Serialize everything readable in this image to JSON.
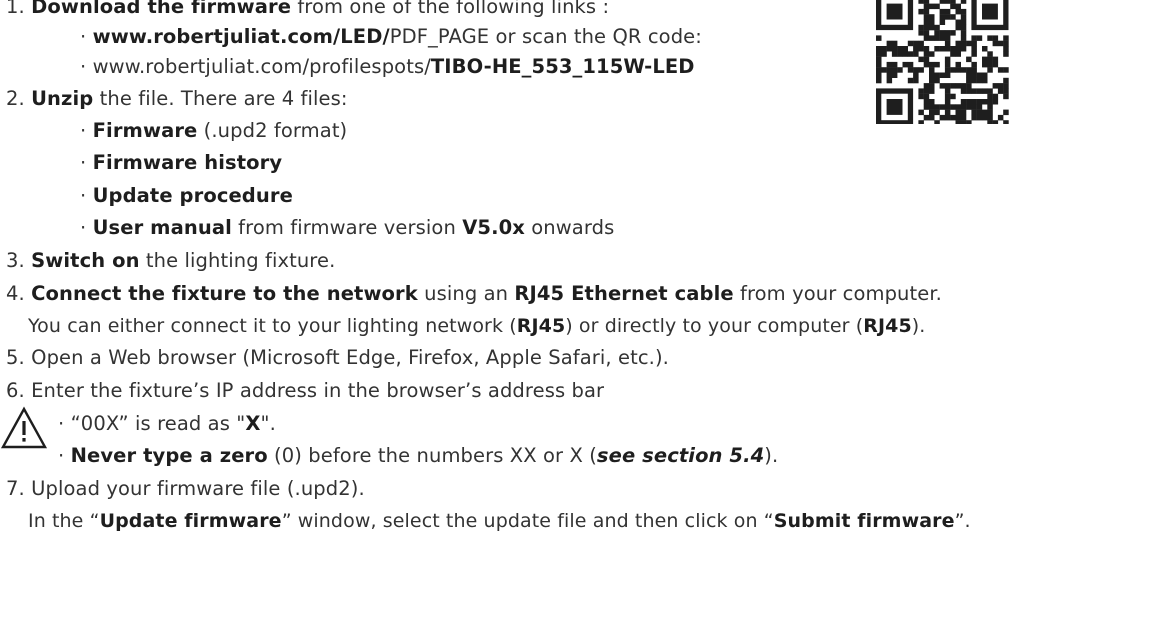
{
  "steps": {
    "s1": {
      "num": "1.",
      "b1": "Download the firmware",
      "t1": " from one of the following links :"
    },
    "s1a": {
      "bullet": "· ",
      "b1": "www.robertjuliat.com/LED/",
      "t1": "PDF_PAGE or scan the QR code:"
    },
    "s1b": {
      "bullet": "· ",
      "t1": "www.robertjuliat.com/profilespots/",
      "b1": "TIBO-HE_553_115W-LED"
    },
    "s2": {
      "num": "2.",
      "b1": "Unzip",
      "t1": " the file. There are 4 files:"
    },
    "s2a": {
      "bullet": "· ",
      "b1": "Firmware",
      "t1": " (.upd2 format)"
    },
    "s2b": {
      "bullet": "· ",
      "b1": "Firmware history"
    },
    "s2c": {
      "bullet": "· ",
      "b1": "Update procedure"
    },
    "s2d": {
      "bullet": "· ",
      "b1": "User manual",
      "t1": " from firmware version ",
      "b2": "V5.0x",
      "t2": " onwards"
    },
    "s3": {
      "num": "3.",
      "b1": "Switch on",
      "t1": " the lighting fixture."
    },
    "s4": {
      "num": "4.",
      "b1": "Connect the fixture to the network",
      "t1": " using an ",
      "b2": "RJ45 Ethernet cable",
      "t2": " from your computer."
    },
    "s4a": {
      "t1": "You can either connect it to your lighting network (",
      "b1": "RJ45",
      "t2": ") or directly to your computer (",
      "b2": "RJ45",
      "t3": ")."
    },
    "s5": {
      "num": "5.",
      "t1": "Open a Web browser (Microsoft Edge, Firefox, Apple Safari, etc.)."
    },
    "s6": {
      "num": "6.",
      "t1": "Enter the fixture’s IP address in the browser’s address bar"
    },
    "s6a": {
      "bullet": "· ",
      "t1": "“00X” is read as \"",
      "b1": "X",
      "t2": "\"."
    },
    "s6b": {
      "bullet": "· ",
      "b1": "Never type a zero",
      "t1": " (0) before the numbers XX or X (",
      "i1": "see section 5.4",
      "t2": ")."
    },
    "s7": {
      "num": "7.",
      "t1": "Upload your firmware file (.upd2)."
    },
    "s7a": {
      "t1": "In the “",
      "b1": "Update firmware",
      "t2": "” window, select the update file and then click on “",
      "b2": "Submit firmware",
      "t3": "”."
    }
  },
  "icons": {
    "qr": "qr-code-icon",
    "warning": "warning-triangle-icon"
  },
  "colors": {
    "text": "#333333",
    "bold_text": "#1e1e1e"
  }
}
